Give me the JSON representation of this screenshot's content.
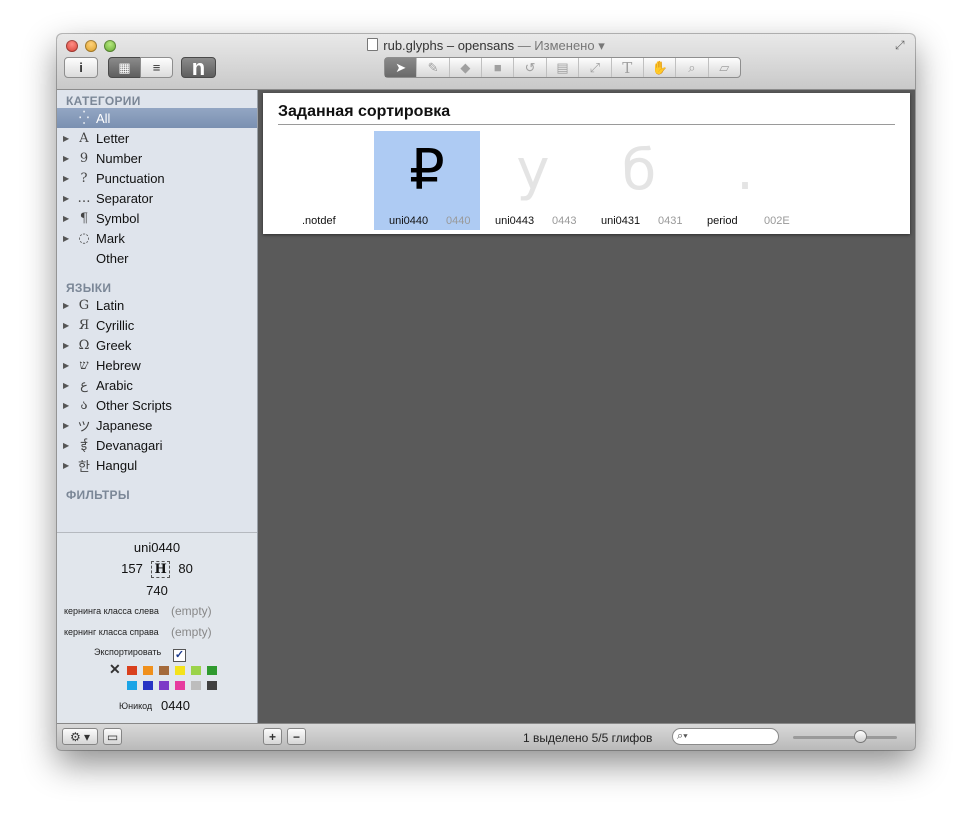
{
  "window": {
    "title": "rub.glyphs – opensans",
    "status": " — Изменено ▾"
  },
  "toolbar": {
    "info_label": "i",
    "grid_label": "▦",
    "list_label": "≡",
    "text_label": "n",
    "tools": [
      "select-tool",
      "pen-tool",
      "eraser-tool",
      "rectangle-tool",
      "rotate-tool",
      "measure-tool",
      "scale-tool",
      "text-tool",
      "hand-tool",
      "zoom-tool",
      "ruler-tool"
    ]
  },
  "sidebar": {
    "categories_heading": "КАТЕГОРИИ",
    "categories": [
      {
        "label": "All",
        "icon": "⁛",
        "selected": true
      },
      {
        "label": "Letter",
        "icon": "A"
      },
      {
        "label": "Number",
        "icon": "9"
      },
      {
        "label": "Punctuation",
        "icon": "?"
      },
      {
        "label": "Separator",
        "icon": "…"
      },
      {
        "label": "Symbol",
        "icon": "¶"
      },
      {
        "label": "Mark",
        "icon": "◌"
      },
      {
        "label": "Other",
        "icon": ""
      }
    ],
    "languages_heading": "ЯЗЫКИ",
    "languages": [
      {
        "label": "Latin",
        "icon": "G"
      },
      {
        "label": "Cyrillic",
        "icon": "Я"
      },
      {
        "label": "Greek",
        "icon": "Ω"
      },
      {
        "label": "Hebrew",
        "icon": "ש"
      },
      {
        "label": "Arabic",
        "icon": "ع"
      },
      {
        "label": "Other Scripts",
        "icon": "ა"
      },
      {
        "label": "Japanese",
        "icon": "ツ"
      },
      {
        "label": "Devanagari",
        "icon": "ई"
      },
      {
        "label": "Hangul",
        "icon": "한"
      }
    ],
    "filters_heading": "ФИЛЬТРЫ"
  },
  "info": {
    "glyph_name": "uni0440",
    "lsb": "157",
    "rsb": "80",
    "width": "740",
    "left_class_label": "кернинга класса слева",
    "left_class_value": "(empty)",
    "right_class_label": "кернинг класса справа",
    "right_class_value": "(empty)",
    "export_label": "Экспортировать",
    "export_checked": "✓",
    "unicode_label": "Юникод",
    "unicode_value": "0440",
    "clear_color": "✕",
    "colors": [
      "#d9401d",
      "#f0901c",
      "#a46a3b",
      "#f4e21b",
      "#9bd34a",
      "#2f9a2f",
      "#1aa4e6",
      "#2733c4",
      "#7c3bc7",
      "#e63b9e",
      "#bdbdbd",
      "#404040"
    ]
  },
  "panel": {
    "title": "Заданная сортировка",
    "glyphs": [
      {
        "name": ".notdef",
        "code": "",
        "char": ""
      },
      {
        "name": "uni0440",
        "code": "0440",
        "char": "₽",
        "selected": true
      },
      {
        "name": "uni0443",
        "code": "0443",
        "char": "у"
      },
      {
        "name": "uni0431",
        "code": "0431",
        "char": "б"
      },
      {
        "name": "period",
        "code": "002E",
        "char": "."
      }
    ]
  },
  "bottom": {
    "gear_label": "⚙ ▾",
    "panel_label": "▭",
    "add_label": "+",
    "remove_label": "−",
    "count_text": "1 выделено 5/5 глифов",
    "search_icon": "magnifier-icon"
  }
}
